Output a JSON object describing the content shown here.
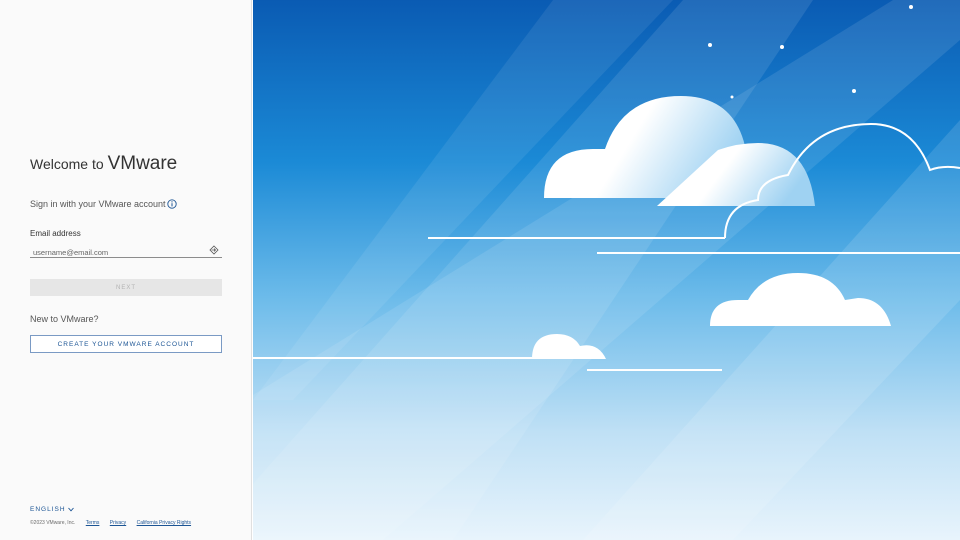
{
  "login": {
    "welcome_prefix": "Welcome to",
    "brand": "VMware",
    "signin_text": "Sign in with your VMware account",
    "email_label": "Email address",
    "email_placeholder": "username@email.com",
    "next_label": "NEXT",
    "new_text": "New to VMware?",
    "create_label": "CREATE YOUR VMWARE ACCOUNT"
  },
  "footer": {
    "language": "ENGLISH",
    "copyright": "©2023 VMware, Inc.",
    "terms": "Terms",
    "privacy": "Privacy",
    "california": "California Privacy Rights"
  },
  "icons": {
    "info": "info-icon",
    "field_action": "arrow-login-icon",
    "language_chevron": "chevron-down-icon"
  },
  "colors": {
    "accent": "#1b5494",
    "sky_top": "#0a5bb3",
    "sky_bottom": "#e8f4fc"
  }
}
